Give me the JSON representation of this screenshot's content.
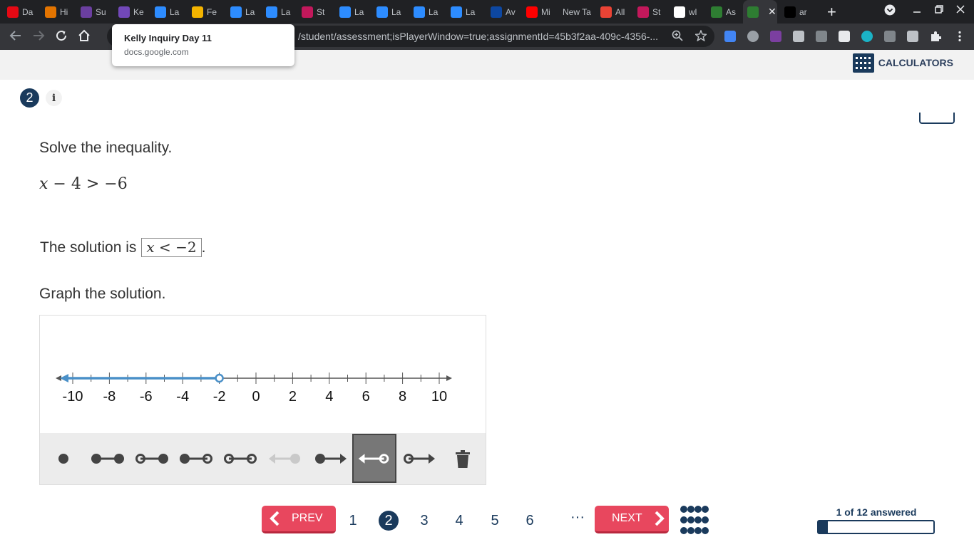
{
  "browser": {
    "tabs": [
      {
        "label": "Da",
        "icon": "netflix-icon",
        "color": "#e50914"
      },
      {
        "label": "Hi",
        "icon": "classroom-icon",
        "color": "#e37400"
      },
      {
        "label": "Su",
        "icon": "quizizz-icon",
        "color": "#6b3fa0"
      },
      {
        "label": "Ke",
        "icon": "forms-icon",
        "color": "#7248b9"
      },
      {
        "label": "La",
        "icon": "zoom-icon",
        "color": "#2d8cff"
      },
      {
        "label": "Fe",
        "icon": "slides-icon",
        "color": "#f4b400"
      },
      {
        "label": "La",
        "icon": "zoom-icon",
        "color": "#2d8cff"
      },
      {
        "label": "La",
        "icon": "zoom-icon",
        "color": "#2d8cff"
      },
      {
        "label": "St",
        "icon": "edpuzzle-icon",
        "color": "#c2185b"
      },
      {
        "label": "La",
        "icon": "zoom-icon",
        "color": "#2d8cff"
      },
      {
        "label": "La",
        "icon": "zoom-icon",
        "color": "#2d8cff"
      },
      {
        "label": "La",
        "icon": "zoom-icon",
        "color": "#2d8cff"
      },
      {
        "label": "La",
        "icon": "zoom-icon",
        "color": "#2d8cff"
      },
      {
        "label": "Av",
        "icon": "tn-icon",
        "color": "#0d47a1"
      },
      {
        "label": "Mi",
        "icon": "youtube-icon",
        "color": "#ff0000"
      },
      {
        "label": "New Ta",
        "icon": "",
        "color": ""
      },
      {
        "label": "All",
        "icon": "gmail-icon",
        "color": "#ea4335"
      },
      {
        "label": "St",
        "icon": "edpuzzle-icon",
        "color": "#c2185b"
      },
      {
        "label": "wl",
        "icon": "google-icon",
        "color": "#ffffff"
      },
      {
        "label": "As",
        "icon": "assessment-icon",
        "color": "#2e7d32"
      },
      {
        "label": "",
        "icon": "assessment-icon",
        "color": "#2e7d32"
      },
      {
        "label": "ar",
        "icon": "brainly-icon",
        "color": "#000000"
      }
    ],
    "url": "/student/assessment;isPlayerWindow=true;assignmentId=45b3f2aa-409c-4356-...",
    "tooltip": {
      "title": "Kelly Inquiry Day 11",
      "domain": "docs.google.com"
    }
  },
  "header": {
    "calculators_label": "CALCULATORS"
  },
  "question": {
    "number": "2",
    "info_label": "i",
    "prompt": "Solve the inequality.",
    "inequality": {
      "var": "x",
      "rest": " − 4 > −6"
    },
    "solution_prefix": "The solution is",
    "solution_answer": {
      "var": "x",
      "rest": " < −2"
    },
    "solution_suffix": ".",
    "graph_prompt": "Graph the solution."
  },
  "number_line": {
    "min": -10,
    "max": 10,
    "step": 1,
    "labels": [
      "-10",
      "-8",
      "-6",
      "-4",
      "-2",
      "0",
      "2",
      "4",
      "6",
      "8",
      "10"
    ],
    "ray": {
      "start": -2,
      "direction": "left",
      "endpoint": "open"
    },
    "color": "#4a90c8"
  },
  "tools": [
    {
      "name": "point-tool",
      "selected": false,
      "disabled": false
    },
    {
      "name": "closed-closed-segment-tool",
      "selected": false,
      "disabled": false
    },
    {
      "name": "open-closed-segment-tool",
      "selected": false,
      "disabled": false
    },
    {
      "name": "closed-open-segment-tool",
      "selected": false,
      "disabled": false
    },
    {
      "name": "open-open-segment-tool",
      "selected": false,
      "disabled": false
    },
    {
      "name": "closed-ray-left-tool",
      "selected": false,
      "disabled": true
    },
    {
      "name": "closed-ray-right-tool",
      "selected": false,
      "disabled": false
    },
    {
      "name": "open-ray-left-tool",
      "selected": true,
      "disabled": false
    },
    {
      "name": "open-ray-right-tool",
      "selected": false,
      "disabled": false
    },
    {
      "name": "trash-tool",
      "selected": false,
      "disabled": false
    }
  ],
  "footer": {
    "prev_label": "PREV",
    "next_label": "NEXT",
    "pages": [
      "1",
      "2",
      "3",
      "4",
      "5",
      "6"
    ],
    "current_page": "2",
    "ellipsis": "···",
    "progress_label": "1 of 12 answered",
    "progress_fraction": 0.0833
  },
  "colors": {
    "navy": "#1a3a5c",
    "accent": "#e8475e"
  }
}
